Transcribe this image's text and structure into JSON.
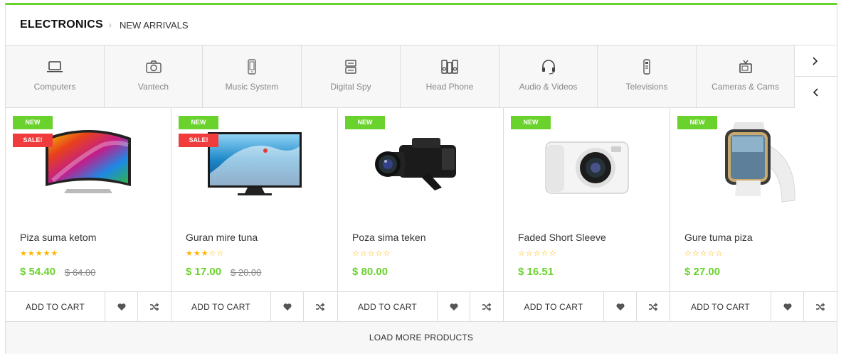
{
  "header": {
    "title": "ELECTRONICS",
    "separator": "›",
    "subtitle": "NEW ARRIVALS"
  },
  "categories": [
    {
      "label": "Computers",
      "icon": "laptop-icon"
    },
    {
      "label": "Vantech",
      "icon": "camera-icon"
    },
    {
      "label": "Music System",
      "icon": "phone-icon"
    },
    {
      "label": "Digital Spy",
      "icon": "server-icon"
    },
    {
      "label": "Head Phone",
      "icon": "speakers-icon"
    },
    {
      "label": "Audio & Videos",
      "icon": "headset-icon"
    },
    {
      "label": "Televisions",
      "icon": "remote-icon"
    },
    {
      "label": "Cameras & Cams",
      "icon": "tv-icon"
    }
  ],
  "category_nav": {
    "next_icon": "chevron-right-icon",
    "prev_icon": "chevron-left-icon"
  },
  "products": [
    {
      "name": "Piza suma ketom",
      "new_badge": "NEW",
      "sale_badge": "SALE!",
      "rating": 5,
      "price": "$ 54.40",
      "old_price": "$ 64.00",
      "image": "curved-tv"
    },
    {
      "name": "Guran mire tuna",
      "new_badge": "NEW",
      "sale_badge": "SALE!",
      "rating": 3,
      "price": "$ 17.00",
      "old_price": "$ 20.00",
      "image": "flat-tv"
    },
    {
      "name": "Poza sima teken",
      "new_badge": "NEW",
      "sale_badge": "",
      "rating": 0,
      "price": "$ 80.00",
      "old_price": "",
      "image": "camcorder"
    },
    {
      "name": "Faded Short Sleeve",
      "new_badge": "NEW",
      "sale_badge": "",
      "rating": 0,
      "price": "$ 16.51",
      "old_price": "",
      "image": "digital-camera"
    },
    {
      "name": "Gure tuma piza",
      "new_badge": "NEW",
      "sale_badge": "",
      "rating": 0,
      "price": "$ 27.00",
      "old_price": "",
      "image": "smartwatch"
    }
  ],
  "actions": {
    "add_to_cart": "ADD TO CART",
    "wishlist_icon": "heart-icon",
    "compare_icon": "shuffle-icon"
  },
  "load_more": "LOAD MORE PRODUCTS",
  "colors": {
    "accent": "#6ad22c",
    "sale": "#f03c3c",
    "star": "#ffb400",
    "border": "#dcdcdc"
  },
  "rating_max": 5
}
